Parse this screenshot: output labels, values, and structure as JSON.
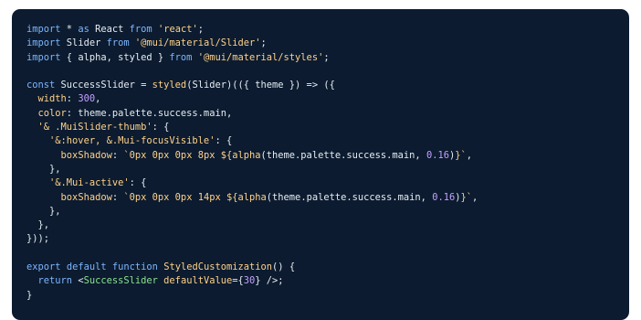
{
  "colors": {
    "background": "#ffffff",
    "panel": "#0c1b2f",
    "keyword": "#7cb6ff",
    "string": "#ffd28a",
    "number": "#c3a0ff",
    "plain": "#e6edf3",
    "tag": "#8be28f"
  },
  "code": {
    "lines": [
      [
        [
          "kw",
          "import"
        ],
        [
          "pl",
          " * "
        ],
        [
          "kw",
          "as"
        ],
        [
          "pl",
          " React "
        ],
        [
          "kw",
          "from"
        ],
        [
          "pl",
          " "
        ],
        [
          "str",
          "'react'"
        ],
        [
          "pl",
          ";"
        ]
      ],
      [
        [
          "kw",
          "import"
        ],
        [
          "pl",
          " Slider "
        ],
        [
          "kw",
          "from"
        ],
        [
          "pl",
          " "
        ],
        [
          "str",
          "'@mui/material/Slider'"
        ],
        [
          "pl",
          ";"
        ]
      ],
      [
        [
          "kw",
          "import"
        ],
        [
          "pl",
          " { alpha, styled } "
        ],
        [
          "kw",
          "from"
        ],
        [
          "pl",
          " "
        ],
        [
          "str",
          "'@mui/material/styles'"
        ],
        [
          "pl",
          ";"
        ]
      ],
      [],
      [
        [
          "kw",
          "const"
        ],
        [
          "pl",
          " SuccessSlider = "
        ],
        [
          "fn",
          "styled"
        ],
        [
          "pl",
          "(Slider)(({ theme }) => ({"
        ]
      ],
      [
        [
          "pl",
          "  "
        ],
        [
          "prop",
          "width"
        ],
        [
          "pl",
          ": "
        ],
        [
          "num",
          "300"
        ],
        [
          "pl",
          ","
        ]
      ],
      [
        [
          "pl",
          "  "
        ],
        [
          "prop",
          "color"
        ],
        [
          "pl",
          ": theme.palette.success.main,"
        ]
      ],
      [
        [
          "pl",
          "  "
        ],
        [
          "str",
          "'& .MuiSlider-thumb'"
        ],
        [
          "pl",
          ": {"
        ]
      ],
      [
        [
          "pl",
          "    "
        ],
        [
          "str",
          "'&:hover, &.Mui-focusVisible'"
        ],
        [
          "pl",
          ": {"
        ]
      ],
      [
        [
          "pl",
          "      "
        ],
        [
          "prop",
          "boxShadow"
        ],
        [
          "pl",
          ": "
        ],
        [
          "str",
          "`0px 0px 0px 8px ${"
        ],
        [
          "fn",
          "alpha"
        ],
        [
          "pl",
          "(theme.palette.success.main, "
        ],
        [
          "num",
          "0.16"
        ],
        [
          "pl",
          ")"
        ],
        [
          "str",
          "}`"
        ],
        [
          "pl",
          ","
        ]
      ],
      [
        [
          "pl",
          "    },"
        ]
      ],
      [
        [
          "pl",
          "    "
        ],
        [
          "str",
          "'&.Mui-active'"
        ],
        [
          "pl",
          ": {"
        ]
      ],
      [
        [
          "pl",
          "      "
        ],
        [
          "prop",
          "boxShadow"
        ],
        [
          "pl",
          ": "
        ],
        [
          "str",
          "`0px 0px 0px 14px ${"
        ],
        [
          "fn",
          "alpha"
        ],
        [
          "pl",
          "(theme.palette.success.main, "
        ],
        [
          "num",
          "0.16"
        ],
        [
          "pl",
          ")"
        ],
        [
          "str",
          "}`"
        ],
        [
          "pl",
          ","
        ]
      ],
      [
        [
          "pl",
          "    },"
        ]
      ],
      [
        [
          "pl",
          "  },"
        ]
      ],
      [
        [
          "pl",
          "}));"
        ]
      ],
      [],
      [
        [
          "kw",
          "export"
        ],
        [
          "pl",
          " "
        ],
        [
          "kw",
          "default"
        ],
        [
          "pl",
          " "
        ],
        [
          "kw",
          "function"
        ],
        [
          "pl",
          " "
        ],
        [
          "fn",
          "StyledCustomization"
        ],
        [
          "pl",
          "() {"
        ]
      ],
      [
        [
          "pl",
          "  "
        ],
        [
          "kw",
          "return"
        ],
        [
          "pl",
          " <"
        ],
        [
          "tag",
          "SuccessSlider"
        ],
        [
          "pl",
          " "
        ],
        [
          "fn",
          "defaultValue"
        ],
        [
          "pl",
          "={"
        ],
        [
          "num",
          "30"
        ],
        [
          "pl",
          "} />;"
        ]
      ],
      [
        [
          "pl",
          "}"
        ]
      ]
    ]
  }
}
